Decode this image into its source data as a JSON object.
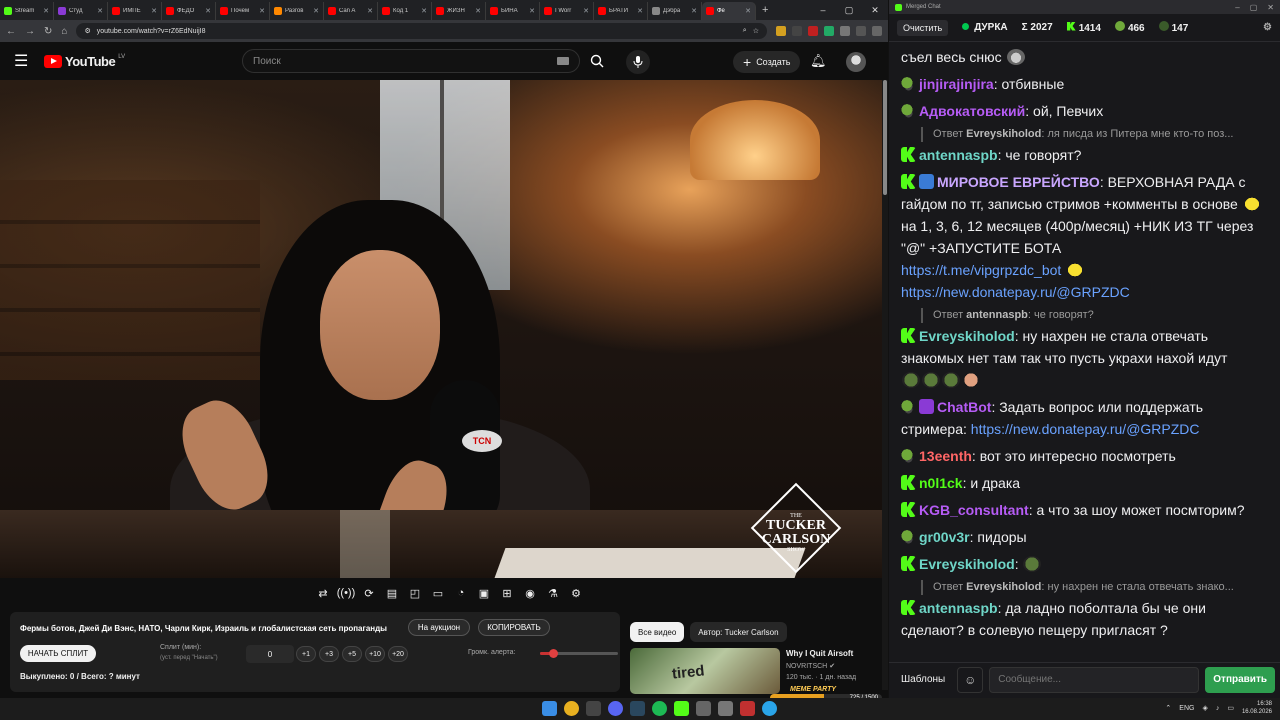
{
  "browser": {
    "tabs": [
      {
        "label": "Stream",
        "color": "#53fc18"
      },
      {
        "label": "Студ",
        "color": "#8a3ad5"
      },
      {
        "label": "ИМПЕ",
        "color": "#ff0000"
      },
      {
        "label": "ФЕДО",
        "color": "#ff0000"
      },
      {
        "label": "Почем",
        "color": "#ff0000"
      },
      {
        "label": "Разгов",
        "color": "#ff8800"
      },
      {
        "label": "Can A",
        "color": "#ff0000"
      },
      {
        "label": "Код 1",
        "color": "#ff0000"
      },
      {
        "label": "ЖИЗН",
        "color": "#ff0000"
      },
      {
        "label": "БИНА",
        "color": "#ff0000"
      },
      {
        "label": "I Worr",
        "color": "#ff0000"
      },
      {
        "label": "БРАТИ",
        "color": "#ff0000"
      },
      {
        "label": "Дэбра",
        "color": "#888888"
      },
      {
        "label": "Фе",
        "color": "#ff0000",
        "active": true
      }
    ],
    "url": "youtube.com/watch?v=rZ6EdNuijI8"
  },
  "youtube": {
    "logo_text": "YouTube",
    "country": "LV",
    "search_placeholder": "Поиск",
    "create_label": "Создать",
    "video_badge": "TCN",
    "show_logo": {
      "the": "THE",
      "line1": "TUCKER",
      "line2": "CARLSON",
      "show": "SHOW"
    }
  },
  "extension": {
    "title": "Фермы ботов, Джей Ди Вэнс, НАТО, Чарли Кирк, Израиль и глобалистская сеть пропаганды",
    "auction_label": "На аукцион",
    "copy_label": "КОПИРОВАТЬ",
    "start_split_label": "НАЧАТЬ СПЛИТ",
    "split_label": "Сплит (мин):",
    "split_hint": "(уст. перед \"Начать\")",
    "split_value": "0",
    "chips": [
      "+1",
      "+3",
      "+5",
      "+10",
      "+20"
    ],
    "alert_volume_label": "Громк. алерта:",
    "alert_volume": 0.17,
    "footer": "Выкуплено: 0 / Всего: ? минут"
  },
  "sidebar": {
    "chip_all": "Все видео",
    "chip_author": "Автор: Tucker Carlson",
    "rec": {
      "thumb_text": "tired",
      "title": "Why I Quit Airsoft",
      "channel": "NOVRITSCH",
      "meta": "120 тыс. · 1 дн. назад"
    }
  },
  "meme_party": {
    "label": "MEME PARTY",
    "count": "725 / 1500",
    "progress": 0.48
  },
  "chat": {
    "window_title": "Merged Chat",
    "clear_label": "Очистить",
    "channel": "ДУРКА",
    "total": "Σ 2027",
    "kick_count": "1414",
    "pepe_count": "466",
    "viewers": "147",
    "messages": [
      {
        "badge": "none",
        "user": "",
        "color": "#efeff1",
        "text": "съел весь снюс",
        "emotes": [
          "cat"
        ]
      },
      {
        "badge": "pepe",
        "user": "jinjirajinjira",
        "color": "#b65cf5",
        "text": "отбивные"
      },
      {
        "badge": "pepe",
        "user": "Адвокатовский",
        "color": "#b65cf5",
        "text": "ой, Певчих"
      },
      {
        "reply_user": "Evreyskiholod",
        "reply_text": "ля писда из Питера мне кто-то поз..."
      },
      {
        "badge": "kick",
        "user": "antennaspb",
        "color": "#6fd6c8",
        "text": "че говорят?"
      },
      {
        "badge": "kick-mod",
        "user": "МИРОВОЕ ЕВРЕЙСТВО",
        "color": "#c9a6ff",
        "text": "ВЕРХОВНАЯ РАДА с гайдом по тг, записью стримов +комменты в основе",
        "text2": "на 1, 3, 6, 12 месяцев (400р/месяц) +НИК ИЗ ТГ через \"@\" +ЗАПУСТИТЕ БОТА",
        "link1": "https://t.me/vipgrpzdc_bot",
        "link2": "https://new.donatepay.ru/@GRPZDC"
      },
      {
        "reply_user": "antennaspb",
        "reply_text": "че говорят?"
      },
      {
        "badge": "kick",
        "user": "Evreyskiholod",
        "color": "#6fd6c8",
        "text": "ну нахрен не стала отвечать знакомых нет там так что пусть украхи нахой идут"
      },
      {
        "badge": "pepe-bot",
        "user": "ChatBot",
        "color": "#b65cf5",
        "text": "Задать вопрос или поддержать стримера:",
        "link1": "https://new.donatepay.ru/@GRPZDC"
      },
      {
        "badge": "pepe",
        "user": "13eenth",
        "color": "#ff6666",
        "text": "вот это интересно посмотреть"
      },
      {
        "badge": "kick",
        "user": "n0l1ck",
        "color": "#53fc18",
        "text": "и драка"
      },
      {
        "badge": "kick",
        "user": "KGB_consultant",
        "color": "#b65cf5",
        "text": "а что за шоу может посмторим?"
      },
      {
        "badge": "pepe",
        "user": "gr00v3r",
        "color": "#6fd6c8",
        "text": "пидоры"
      },
      {
        "badge": "kick",
        "user": "Evreyskiholod",
        "color": "#6fd6c8",
        "text": ""
      },
      {
        "reply_user": "Evreyskiholod",
        "reply_text": "ну нахрен не стала отвечать знако..."
      },
      {
        "badge": "kick",
        "user": "antennaspb",
        "color": "#6fd6c8",
        "text": "да ладно поболтала бы че они сделают? в солевую пещеру пригласят ?"
      }
    ],
    "templates_label": "Шаблоны",
    "input_placeholder": "Сообщение...",
    "send_label": "Отправить"
  },
  "taskbar": {
    "lang": "ENG",
    "time": "16:38",
    "date": "16.08.2026"
  }
}
